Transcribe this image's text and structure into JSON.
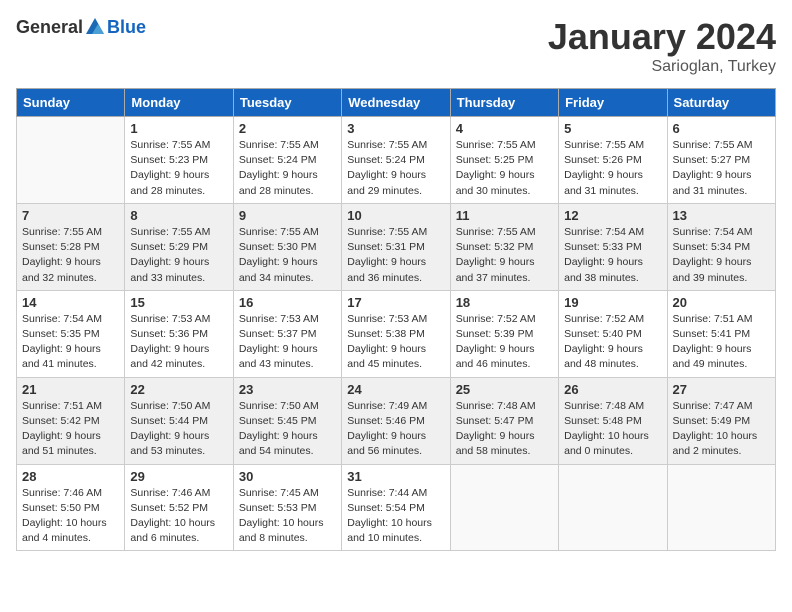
{
  "header": {
    "logo_general": "General",
    "logo_blue": "Blue",
    "month": "January 2024",
    "location": "Sarioglan, Turkey"
  },
  "weekdays": [
    "Sunday",
    "Monday",
    "Tuesday",
    "Wednesday",
    "Thursday",
    "Friday",
    "Saturday"
  ],
  "weeks": [
    [
      {
        "day": "",
        "empty": true
      },
      {
        "day": "1",
        "sunrise": "7:55 AM",
        "sunset": "5:23 PM",
        "daylight": "9 hours and 28 minutes."
      },
      {
        "day": "2",
        "sunrise": "7:55 AM",
        "sunset": "5:24 PM",
        "daylight": "9 hours and 28 minutes."
      },
      {
        "day": "3",
        "sunrise": "7:55 AM",
        "sunset": "5:24 PM",
        "daylight": "9 hours and 29 minutes."
      },
      {
        "day": "4",
        "sunrise": "7:55 AM",
        "sunset": "5:25 PM",
        "daylight": "9 hours and 30 minutes."
      },
      {
        "day": "5",
        "sunrise": "7:55 AM",
        "sunset": "5:26 PM",
        "daylight": "9 hours and 31 minutes."
      },
      {
        "day": "6",
        "sunrise": "7:55 AM",
        "sunset": "5:27 PM",
        "daylight": "9 hours and 31 minutes."
      }
    ],
    [
      {
        "day": "7",
        "sunrise": "7:55 AM",
        "sunset": "5:28 PM",
        "daylight": "9 hours and 32 minutes."
      },
      {
        "day": "8",
        "sunrise": "7:55 AM",
        "sunset": "5:29 PM",
        "daylight": "9 hours and 33 minutes."
      },
      {
        "day": "9",
        "sunrise": "7:55 AM",
        "sunset": "5:30 PM",
        "daylight": "9 hours and 34 minutes."
      },
      {
        "day": "10",
        "sunrise": "7:55 AM",
        "sunset": "5:31 PM",
        "daylight": "9 hours and 36 minutes."
      },
      {
        "day": "11",
        "sunrise": "7:55 AM",
        "sunset": "5:32 PM",
        "daylight": "9 hours and 37 minutes."
      },
      {
        "day": "12",
        "sunrise": "7:54 AM",
        "sunset": "5:33 PM",
        "daylight": "9 hours and 38 minutes."
      },
      {
        "day": "13",
        "sunrise": "7:54 AM",
        "sunset": "5:34 PM",
        "daylight": "9 hours and 39 minutes."
      }
    ],
    [
      {
        "day": "14",
        "sunrise": "7:54 AM",
        "sunset": "5:35 PM",
        "daylight": "9 hours and 41 minutes."
      },
      {
        "day": "15",
        "sunrise": "7:53 AM",
        "sunset": "5:36 PM",
        "daylight": "9 hours and 42 minutes."
      },
      {
        "day": "16",
        "sunrise": "7:53 AM",
        "sunset": "5:37 PM",
        "daylight": "9 hours and 43 minutes."
      },
      {
        "day": "17",
        "sunrise": "7:53 AM",
        "sunset": "5:38 PM",
        "daylight": "9 hours and 45 minutes."
      },
      {
        "day": "18",
        "sunrise": "7:52 AM",
        "sunset": "5:39 PM",
        "daylight": "9 hours and 46 minutes."
      },
      {
        "day": "19",
        "sunrise": "7:52 AM",
        "sunset": "5:40 PM",
        "daylight": "9 hours and 48 minutes."
      },
      {
        "day": "20",
        "sunrise": "7:51 AM",
        "sunset": "5:41 PM",
        "daylight": "9 hours and 49 minutes."
      }
    ],
    [
      {
        "day": "21",
        "sunrise": "7:51 AM",
        "sunset": "5:42 PM",
        "daylight": "9 hours and 51 minutes."
      },
      {
        "day": "22",
        "sunrise": "7:50 AM",
        "sunset": "5:44 PM",
        "daylight": "9 hours and 53 minutes."
      },
      {
        "day": "23",
        "sunrise": "7:50 AM",
        "sunset": "5:45 PM",
        "daylight": "9 hours and 54 minutes."
      },
      {
        "day": "24",
        "sunrise": "7:49 AM",
        "sunset": "5:46 PM",
        "daylight": "9 hours and 56 minutes."
      },
      {
        "day": "25",
        "sunrise": "7:48 AM",
        "sunset": "5:47 PM",
        "daylight": "9 hours and 58 minutes."
      },
      {
        "day": "26",
        "sunrise": "7:48 AM",
        "sunset": "5:48 PM",
        "daylight": "10 hours and 0 minutes."
      },
      {
        "day": "27",
        "sunrise": "7:47 AM",
        "sunset": "5:49 PM",
        "daylight": "10 hours and 2 minutes."
      }
    ],
    [
      {
        "day": "28",
        "sunrise": "7:46 AM",
        "sunset": "5:50 PM",
        "daylight": "10 hours and 4 minutes."
      },
      {
        "day": "29",
        "sunrise": "7:46 AM",
        "sunset": "5:52 PM",
        "daylight": "10 hours and 6 minutes."
      },
      {
        "day": "30",
        "sunrise": "7:45 AM",
        "sunset": "5:53 PM",
        "daylight": "10 hours and 8 minutes."
      },
      {
        "day": "31",
        "sunrise": "7:44 AM",
        "sunset": "5:54 PM",
        "daylight": "10 hours and 10 minutes."
      },
      {
        "day": "",
        "empty": true
      },
      {
        "day": "",
        "empty": true
      },
      {
        "day": "",
        "empty": true
      }
    ]
  ]
}
